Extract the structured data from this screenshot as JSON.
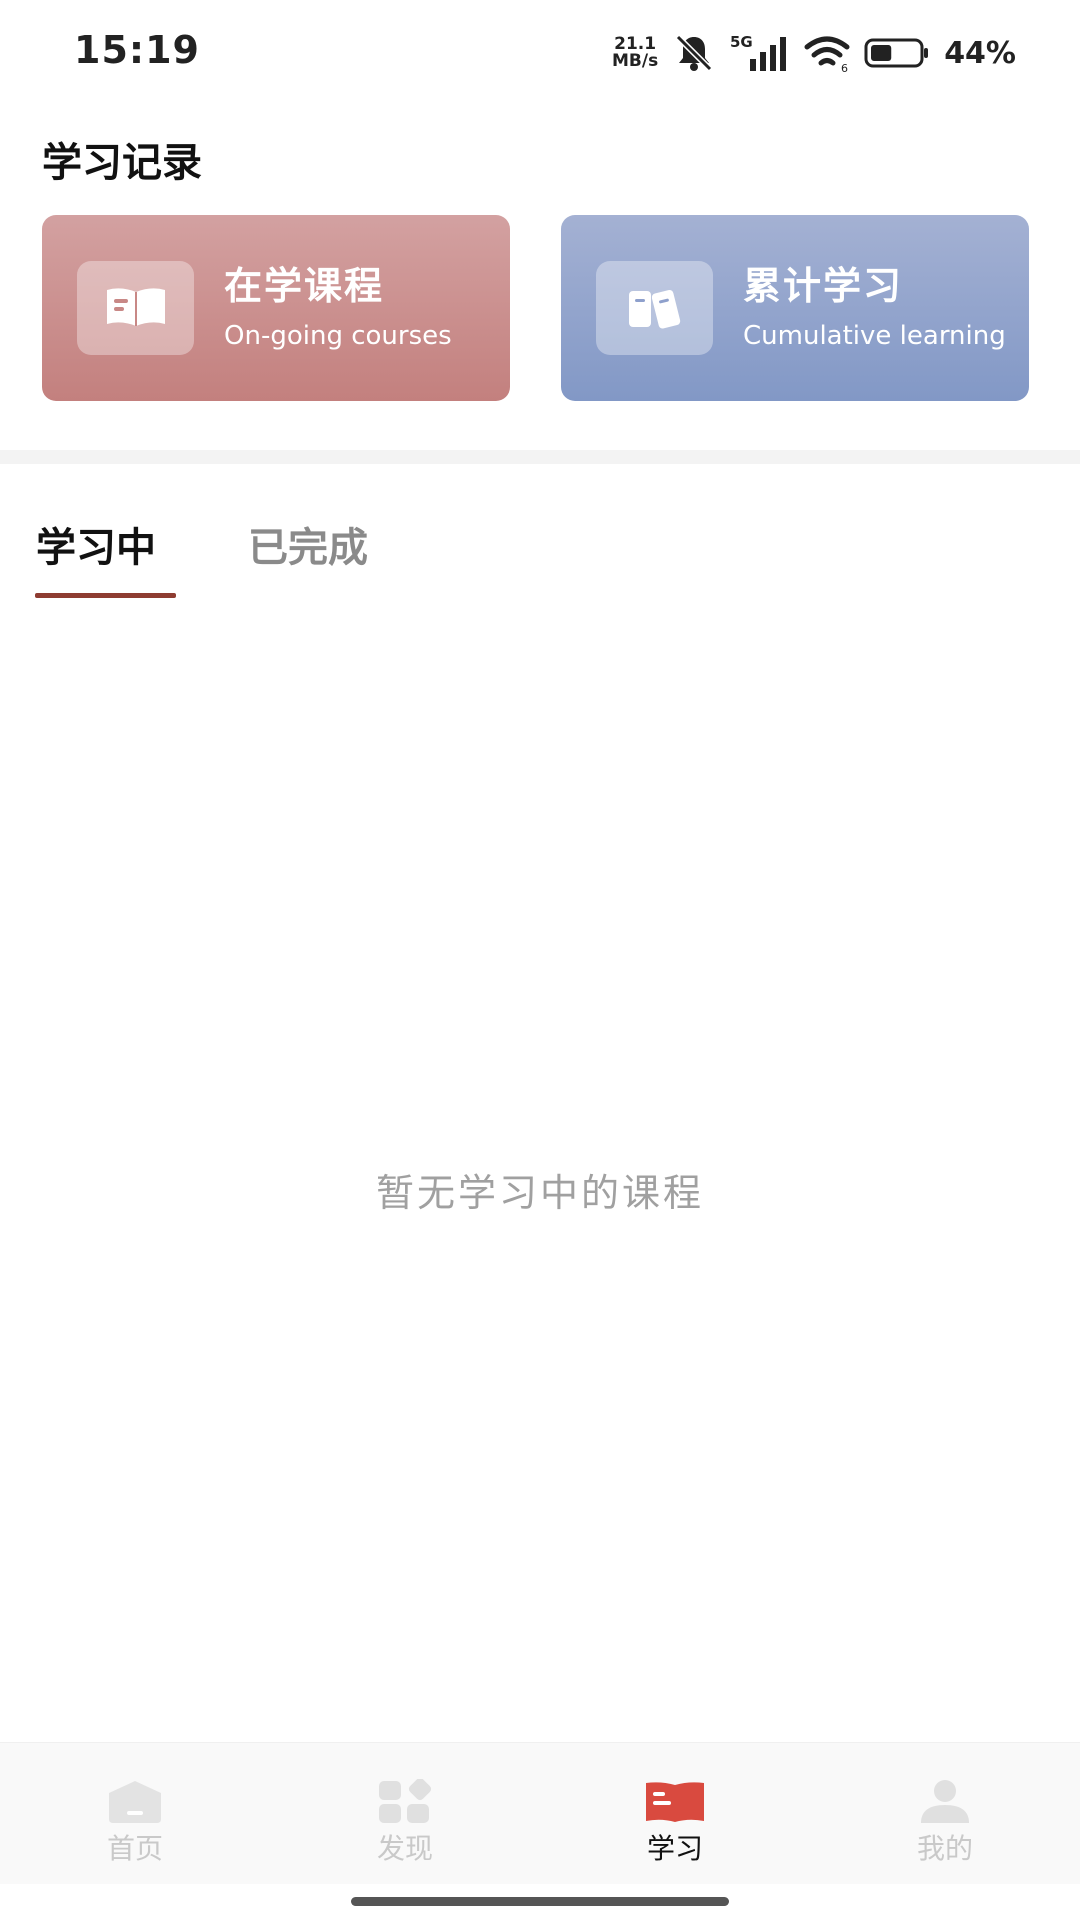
{
  "status_bar": {
    "time": "15:19",
    "net_speed_value": "21.1",
    "net_speed_unit": "MB/s",
    "network_type": "5G",
    "battery_percent": "44%",
    "battery_level": 0.44,
    "icons": [
      "mute-bell-icon",
      "signal-icon",
      "wifi-icon",
      "battery-icon"
    ]
  },
  "records": {
    "title": "学习记录",
    "cards": [
      {
        "title": "在学课程",
        "subtitle": "On-going courses",
        "icon": "open-book-icon",
        "color": "#c88886"
      },
      {
        "title": "累计学习",
        "subtitle": "Cumulative learning",
        "icon": "books-icon",
        "color": "#8ea0cc"
      }
    ]
  },
  "tabs": {
    "items": [
      "学习中",
      "已完成"
    ],
    "active_index": 0,
    "underline_color": "#8e3c31"
  },
  "empty_state": {
    "message": "暂无学习中的课程"
  },
  "bottom_nav": {
    "items": [
      {
        "label": "首页",
        "icon": "home-icon"
      },
      {
        "label": "发现",
        "icon": "discover-grid-icon"
      },
      {
        "label": "学习",
        "icon": "study-book-icon"
      },
      {
        "label": "我的",
        "icon": "user-icon"
      }
    ],
    "active_index": 2,
    "active_color": "#d94a3f"
  }
}
